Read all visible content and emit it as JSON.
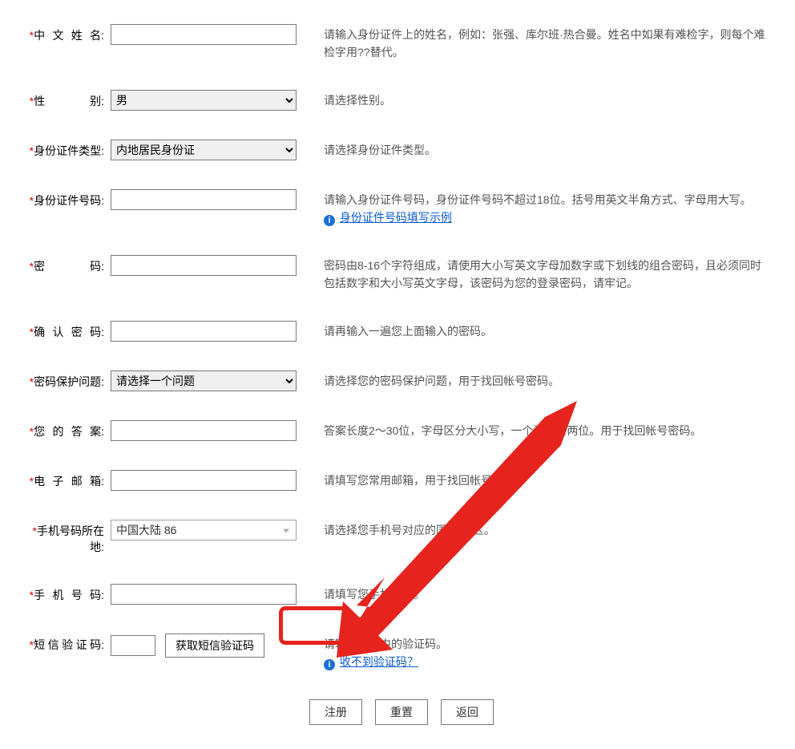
{
  "fields": {
    "name": {
      "label": "中文姓名",
      "hint": "请输入身份证件上的姓名，例如：张强、库尔班·热合曼。姓名中如果有难检字，则每个难检字用??替代。"
    },
    "gender": {
      "label": "性别",
      "value": "男",
      "hint": "请选择性别。"
    },
    "idtype": {
      "label": "身份证件类型",
      "value": "内地居民身份证",
      "hint": "请选择身份证件类型。"
    },
    "idnum": {
      "label": "身份证件号码",
      "hint": "请输入身份证件号码，身份证件号码不超过18位。括号用英文半角方式、字母用大写。",
      "link": "身份证件号码填写示例"
    },
    "password": {
      "label": "密码",
      "hint": "密码由8-16个字符组成，请使用大小写英文字母加数字或下划线的组合密码，且必须同时包括数字和大小写英文字母，该密码为您的登录密码，请牢记。"
    },
    "password2": {
      "label": "确认密码",
      "hint": "请再输入一遍您上面输入的密码。"
    },
    "question": {
      "label": "密码保护问题",
      "value": "请选择一个问题",
      "hint": "请选择您的密码保护问题，用于找回帐号密码。"
    },
    "answer": {
      "label": "您的答案",
      "hint": "答案长度2～30位，字母区分大小写，一个汉字占两位。用于找回帐号密码。"
    },
    "email": {
      "label": "电子邮箱",
      "hint": "请填写您常用邮箱，用于找回帐号密码。"
    },
    "phoneRegion": {
      "label": "手机号码所在地",
      "value": "中国大陆 86",
      "hint": "请选择您手机号对应的国家/地区。"
    },
    "phone": {
      "label": "手机号码",
      "hint": "请填写您手机号码。"
    },
    "sms": {
      "label": "短信验证码",
      "button": "获取短信验证码",
      "hint": "请输入短信中的验证码。",
      "link": "收不到验证码？"
    }
  },
  "actions": {
    "submit": "注册",
    "reset": "重置",
    "back": "返回"
  },
  "symbols": {
    "required": "*",
    "colon": ":"
  }
}
